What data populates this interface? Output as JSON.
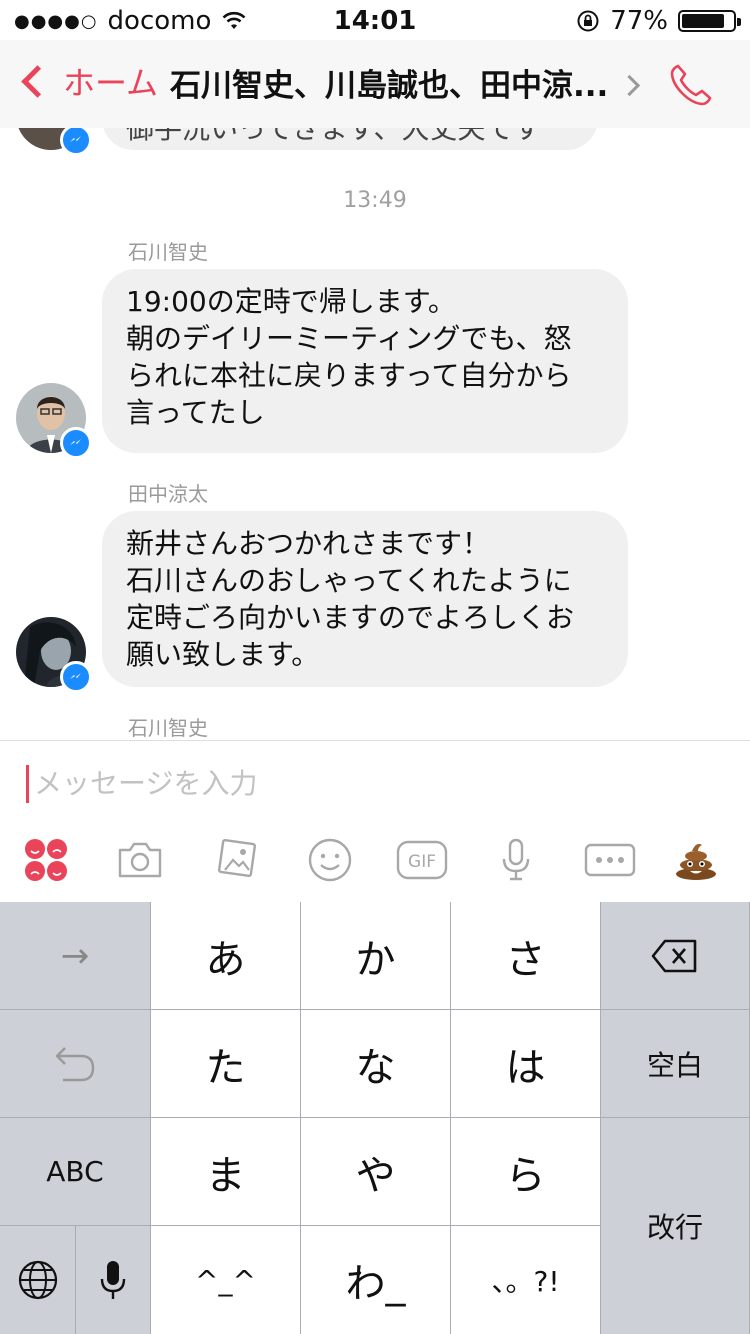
{
  "status_bar": {
    "signal": "●●●●○",
    "carrier": "docomo",
    "time": "14:01",
    "battery_text": "77%",
    "battery_level": 0.77
  },
  "nav": {
    "back_label": "ホーム",
    "title": "石川智史、川島誠也、田中涼..."
  },
  "chat": {
    "prev_bubble_text": "御手洗いってきます、大丈夫です",
    "time_separator": "13:49",
    "messages": [
      {
        "sender": "石川智史",
        "lines": [
          "19:00の定時で帰します。",
          "朝のデイリーミーティングでも、怒",
          "られに本社に戻りますって自分から",
          "言ってたし"
        ]
      },
      {
        "sender": "田中涼太",
        "lines": [
          "新井さんおつかれさまです！",
          "石川さんのおしゃってくれたように",
          "定時ごろ向かいますのでよろしくお",
          "願い致します。"
        ]
      }
    ],
    "next_sender": "石川智史"
  },
  "composer": {
    "placeholder": "メッセージを入力",
    "toolbar": [
      "stickers-icon",
      "camera-icon",
      "photo-icon",
      "emoji-icon",
      "gif-icon",
      "mic-icon",
      "more-icon",
      "poop-icon"
    ],
    "gif_label": "GIF",
    "accent": "#e9445a"
  },
  "keyboard": {
    "arrow_label": "→",
    "row1": [
      "あ",
      "か",
      "さ"
    ],
    "row2": [
      "た",
      "な",
      "は"
    ],
    "row3": [
      "ま",
      "や",
      "ら"
    ],
    "row4": [
      "^_^",
      "わ_",
      "、。?!"
    ],
    "space_label": "空白",
    "abc_label": "ABC",
    "return_label": "改行"
  }
}
